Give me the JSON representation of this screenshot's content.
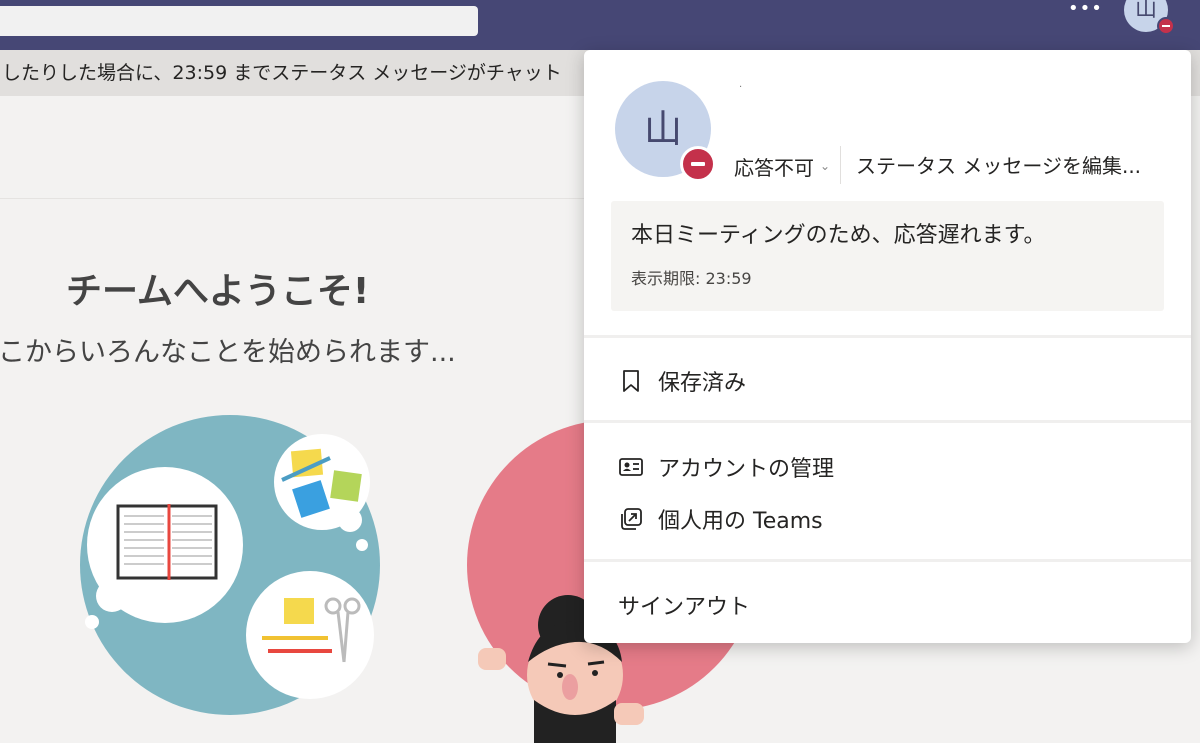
{
  "topbar": {
    "more_label": "•••",
    "avatar_initial": "山"
  },
  "banner": {
    "text": "したりした場合に、23:59 までステータス メッセージがチャット"
  },
  "welcome": {
    "title": "チームへようこそ!",
    "subtitle": "こからいろんなことを始められます..."
  },
  "profile": {
    "avatar_initial": "山",
    "name": "·",
    "status": "応答不可",
    "edit_status_label": "ステータス メッセージを編集...",
    "status_message": "本日ミーティングのため、応答遅れます。",
    "expiry": "表示期限: 23:59"
  },
  "menu": {
    "saved": "保存済み",
    "manage_account": "アカウントの管理",
    "personal_teams": "個人用の Teams",
    "sign_out": "サインアウト"
  },
  "icons": {
    "presence": "do-not-disturb-icon",
    "saved": "bookmark-icon",
    "account": "contact-card-icon",
    "personal": "open-external-icon"
  },
  "colors": {
    "header": "#464775",
    "dnd": "#c4314b",
    "avatar_bg": "#c7d4ea"
  }
}
